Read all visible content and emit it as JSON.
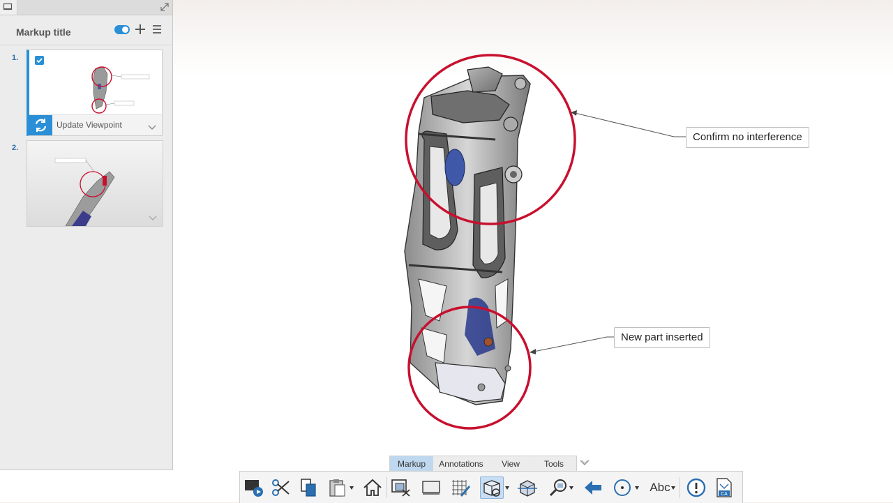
{
  "panel": {
    "title": "Markup title",
    "toggle_on": true,
    "items": [
      {
        "number": "1.",
        "checked": true,
        "action_label": "Update Viewpoint"
      },
      {
        "number": "2."
      }
    ]
  },
  "viewport": {
    "callouts": [
      {
        "text": "Confirm no interference"
      },
      {
        "text": "New part inserted"
      }
    ],
    "markup_color": "#c8102e"
  },
  "tabs": [
    {
      "label": "Markup",
      "active": true
    },
    {
      "label": "Annotations",
      "active": false
    },
    {
      "label": "View",
      "active": false
    },
    {
      "label": "Tools",
      "active": false
    }
  ],
  "toolbar": {
    "text_tool_label": "Abc",
    "icons": [
      "presentation-play-icon",
      "cut-icon",
      "copy-icon",
      "paste-icon",
      "home-icon",
      "fit-selection-icon",
      "display-icon",
      "grid-edit-icon",
      "view-cube-icon",
      "section-box-icon",
      "zoom-window-icon",
      "back-arrow-icon",
      "orbit-icon",
      "text-icon",
      "alert-icon",
      "cad-file-icon"
    ]
  },
  "colors": {
    "accent": "#2a8fd6",
    "tab_active": "#bfd8ef",
    "markup_red": "#c8102e"
  }
}
